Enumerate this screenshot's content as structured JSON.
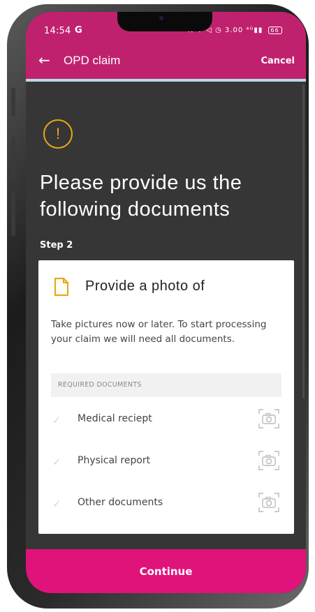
{
  "status_bar": {
    "time": "14:54",
    "g_label": "G",
    "icons_text": "N ✱ ◁ ◷ 3.00 ⁴ᴳ▮▮",
    "battery": "66"
  },
  "app_bar": {
    "title": "OPD claim",
    "cancel_label": "Cancel",
    "back_icon": "arrow-left-icon"
  },
  "colors": {
    "brand": "#c0216f",
    "continue": "#e0137a",
    "warning": "#e8a818",
    "background": "#363636"
  },
  "warning_icon": "!",
  "headline": "Please provide us the following documents",
  "step_label": "Step 2",
  "card": {
    "title": "Provide a photo of",
    "description": "Take pictures now or later. To start processing your claim we will need all documents.",
    "required_header": "REQUIRED DOCUMENTS",
    "documents": [
      {
        "label": "Medical reciept"
      },
      {
        "label": "Physical report"
      },
      {
        "label": "Other documents"
      }
    ]
  },
  "continue_label": "Continue"
}
